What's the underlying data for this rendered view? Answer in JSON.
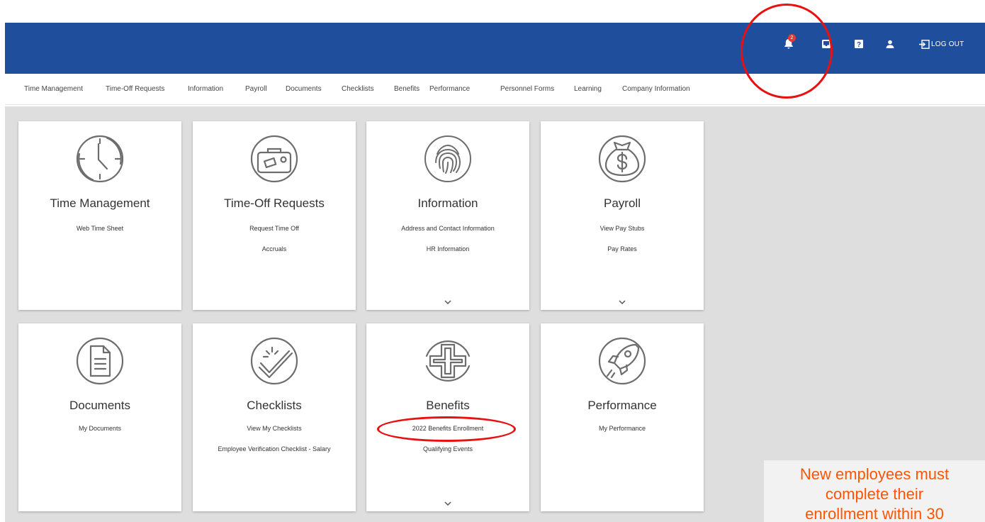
{
  "header": {
    "notification_count": "2",
    "icons": [
      "bell-icon",
      "inbox-icon",
      "help-icon",
      "user-icon",
      "logout-icon"
    ],
    "logout_label": "LOG OUT"
  },
  "nav": {
    "items": [
      "Time Management",
      "Time-Off Requests",
      "Information",
      "Payroll",
      "Documents",
      "Checklists",
      "Benefits",
      "Performance",
      "Personnel Forms",
      "Learning",
      "Company Information"
    ]
  },
  "cards": [
    {
      "title": "Time Management",
      "links": [
        "Web Time Sheet"
      ],
      "icon": "clock-icon",
      "has_more": false
    },
    {
      "title": "Time-Off Requests",
      "links": [
        "Request Time Off",
        "Accruals"
      ],
      "icon": "suitcase-icon",
      "has_more": false
    },
    {
      "title": "Information",
      "links": [
        "Address and Contact Information",
        "HR Information"
      ],
      "icon": "fingerprint-icon",
      "has_more": true
    },
    {
      "title": "Payroll",
      "links": [
        "View Pay Stubs",
        "Pay Rates"
      ],
      "icon": "money-bag-icon",
      "has_more": true
    },
    {
      "title": "Documents",
      "links": [
        "My Documents"
      ],
      "icon": "document-icon",
      "has_more": false
    },
    {
      "title": "Checklists",
      "links": [
        "View My Checklists",
        "Employee Verification Checklist - Salary"
      ],
      "icon": "checkmark-icon",
      "has_more": false
    },
    {
      "title": "Benefits",
      "links": [
        "2022 Benefits Enrollment",
        "Qualifying Events"
      ],
      "icon": "medical-cross-icon",
      "has_more": true
    },
    {
      "title": "Performance",
      "links": [
        "My Performance"
      ],
      "icon": "rocket-icon",
      "has_more": false
    }
  ],
  "note": {
    "line1": "New employees must",
    "line2": "complete their",
    "line3": "enrollment within 30"
  },
  "colors": {
    "header_bg": "#1f4f9c",
    "annotation": "#e81010",
    "note_text": "#ff5500",
    "badge": "#e53935"
  }
}
